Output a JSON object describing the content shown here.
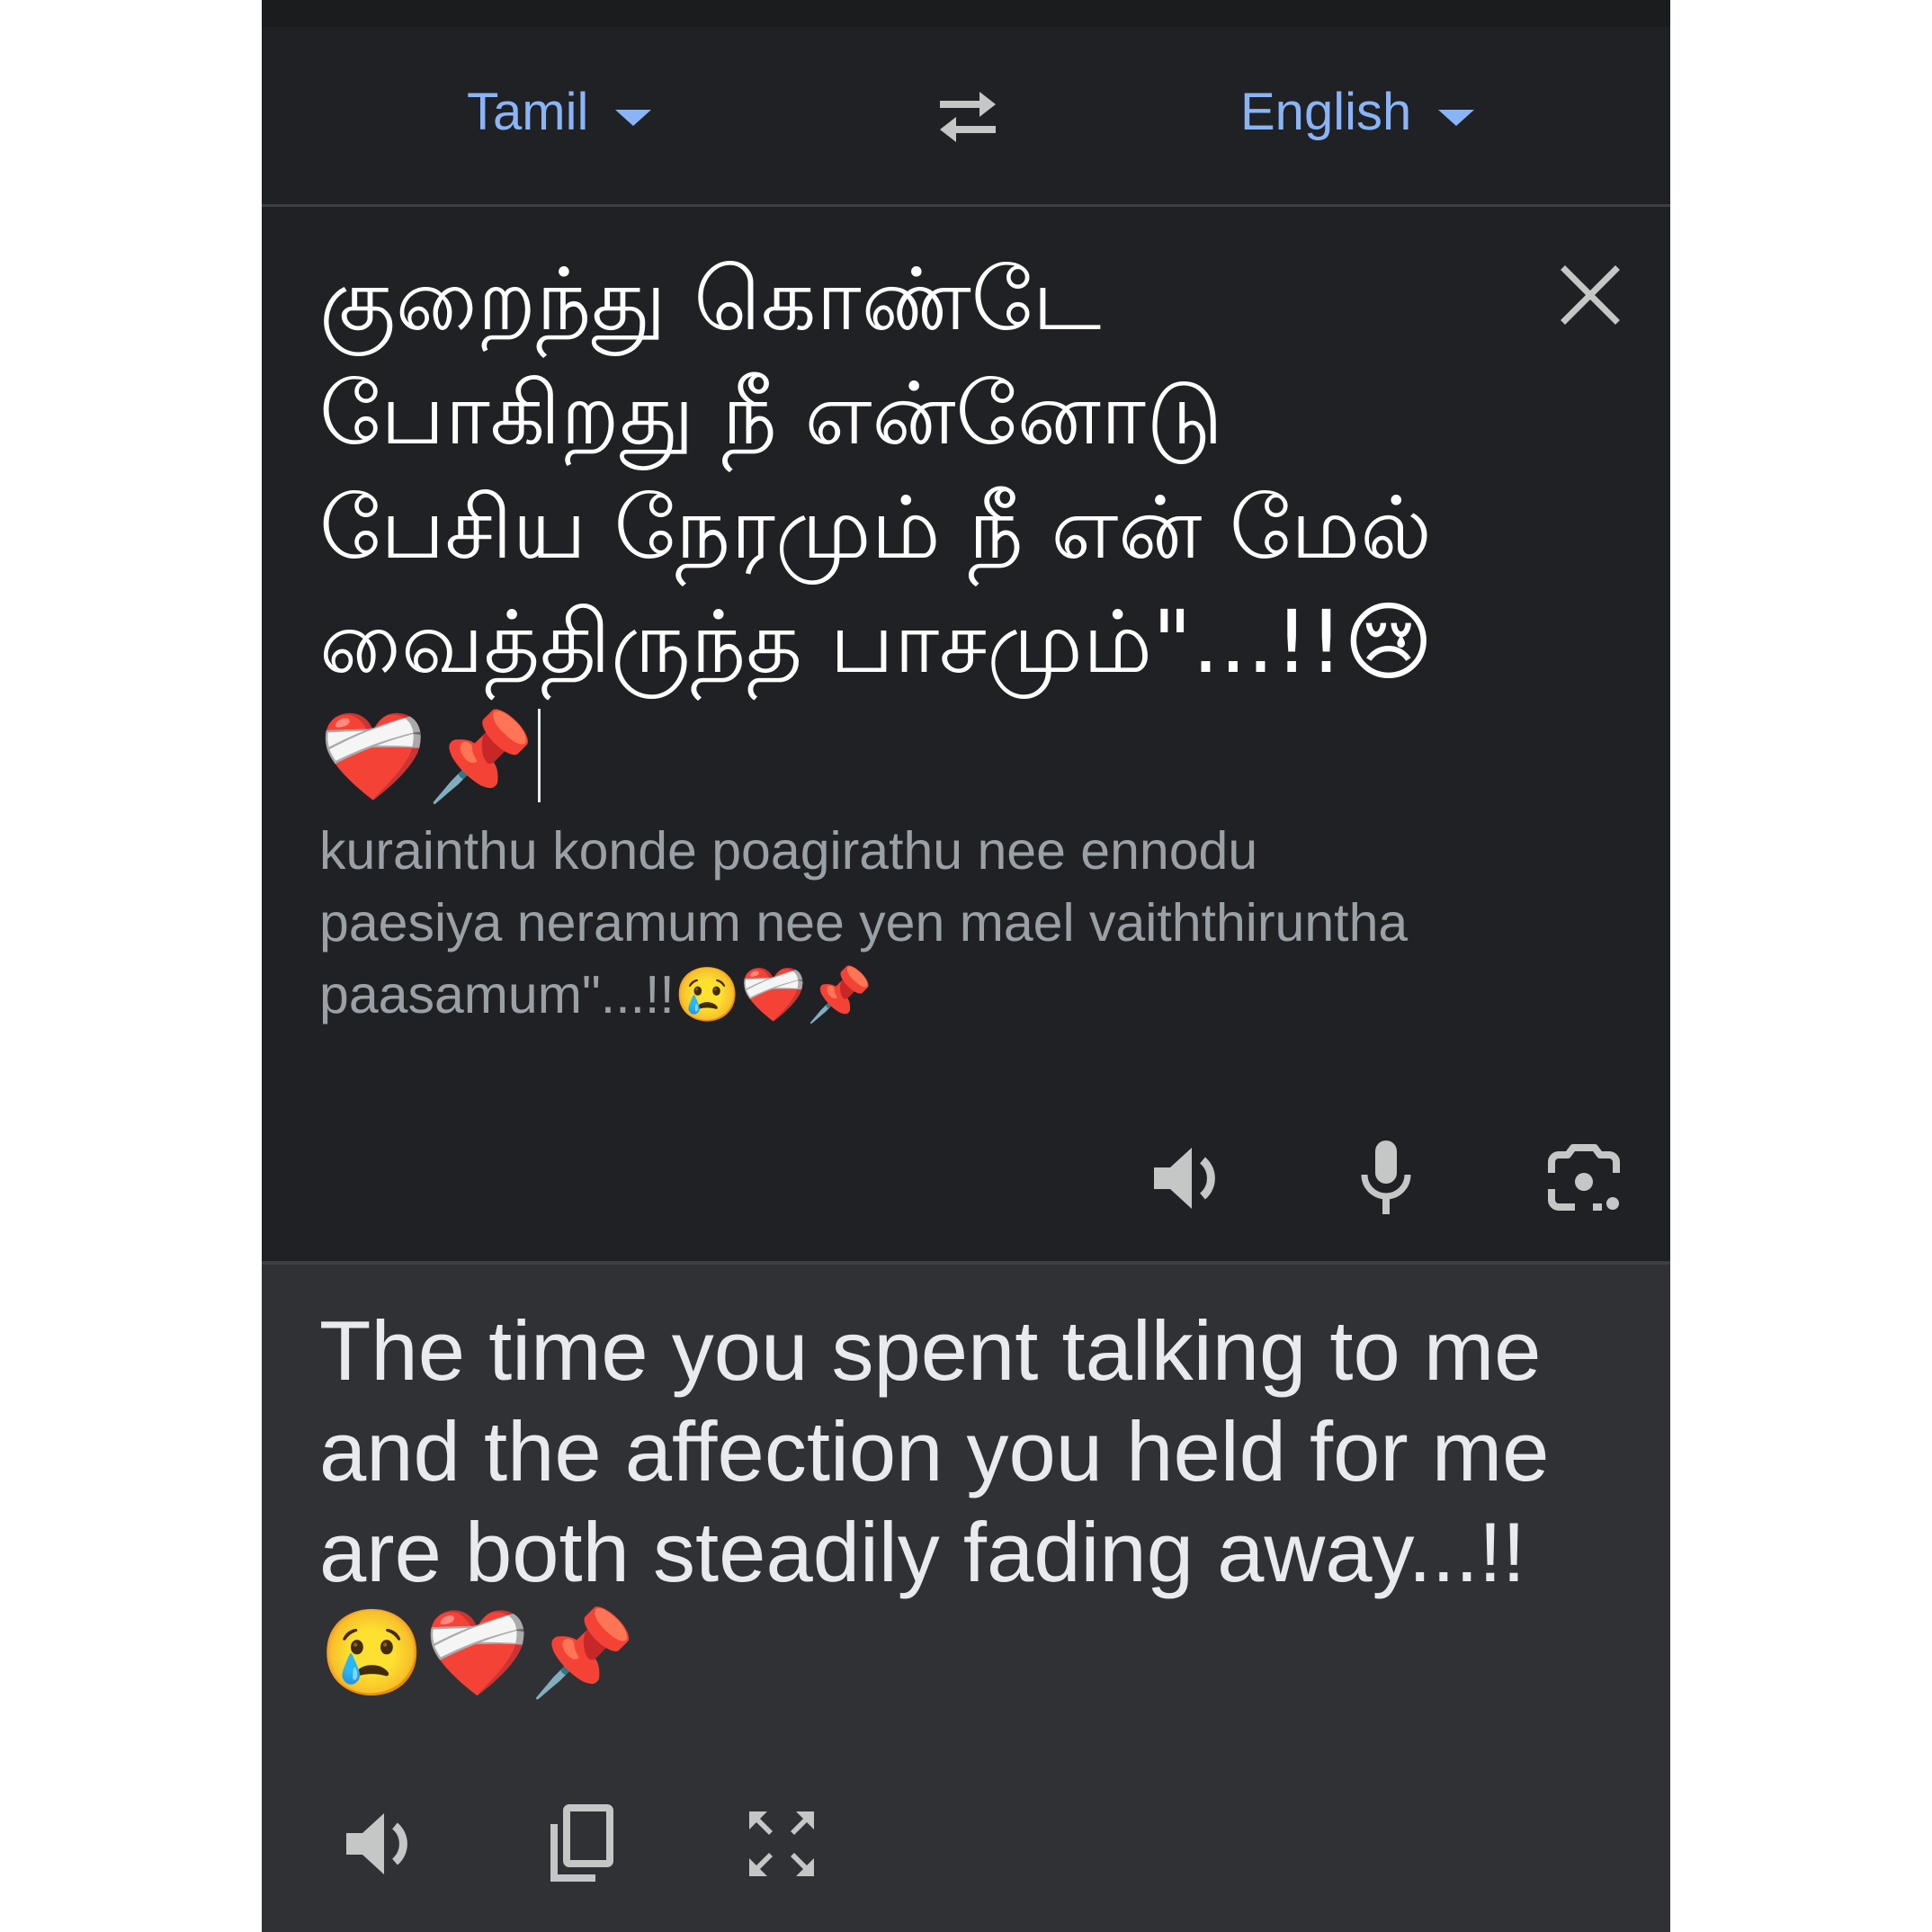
{
  "language_bar": {
    "source_language": "Tamil",
    "target_language": "English"
  },
  "source": {
    "text": "குறைந்து கொண்டே போகிறது நீ என்னோடு பேசிய நேரமும் நீ என் மேல் வைத்திருந்த பாசமும்\"...!!😢❤️‍🩹📌",
    "transliteration": "kurainthu konde poagirathu nee ennodu paesiya neramum nee yen mael vaiththiruntha paasamum\"...!!😢❤️‍🩹📌"
  },
  "result": {
    "text": "The time you spent talking to me and the affection you held for me are both steadily fading away...!! 😢❤️‍🩹📌"
  },
  "icons": {
    "swap": "swap-languages-icon",
    "clear": "close-icon",
    "speaker": "speaker-icon",
    "microphone": "microphone-icon",
    "camera": "camera-icon",
    "copy": "copy-icon",
    "fullscreen": "fullscreen-icon"
  },
  "colors": {
    "background": "#202124",
    "result_background": "#303134",
    "accent": "#8ab4f8",
    "text_primary": "#ffffff",
    "text_secondary": "#9aa0a6",
    "icon": "#c4c7c5"
  }
}
